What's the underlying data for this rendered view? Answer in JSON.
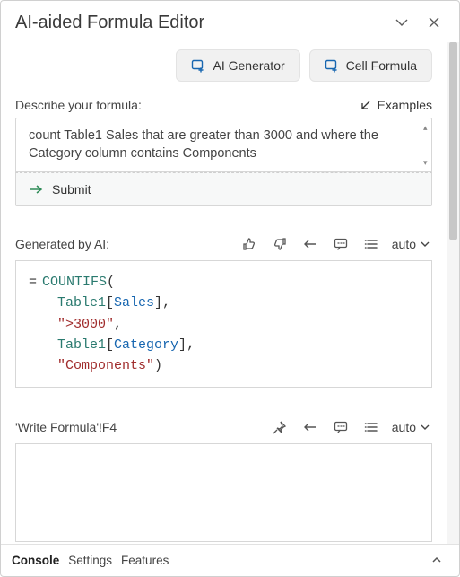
{
  "title": "AI-aided Formula Editor",
  "topButtons": {
    "aiGenerator": "AI Generator",
    "cellFormula": "Cell Formula"
  },
  "describe": {
    "label": "Describe your formula:",
    "examples": "Examples",
    "prompt": "count Table1 Sales that are greater than 3000 and where the Category column contains Components",
    "submit": "Submit"
  },
  "generated": {
    "label": "Generated by AI:",
    "auto": "auto",
    "formula": {
      "eq": "=",
      "fn": "COUNTIFS",
      "open": "(",
      "arg1_table": "Table1",
      "arg1_open": "[",
      "arg1_col": "Sales",
      "arg1_close": "]",
      "comma1": ",",
      "arg2_str": "\">3000\"",
      "comma2": ",",
      "arg3_table": "Table1",
      "arg3_open": "[",
      "arg3_col": "Category",
      "arg3_close": "]",
      "comma3": ",",
      "arg4_str": "\"Components\"",
      "close": ")"
    }
  },
  "cellRef": {
    "label": "'Write Formula'!F4",
    "auto": "auto"
  },
  "tabs": {
    "console": "Console",
    "settings": "Settings",
    "features": "Features"
  }
}
